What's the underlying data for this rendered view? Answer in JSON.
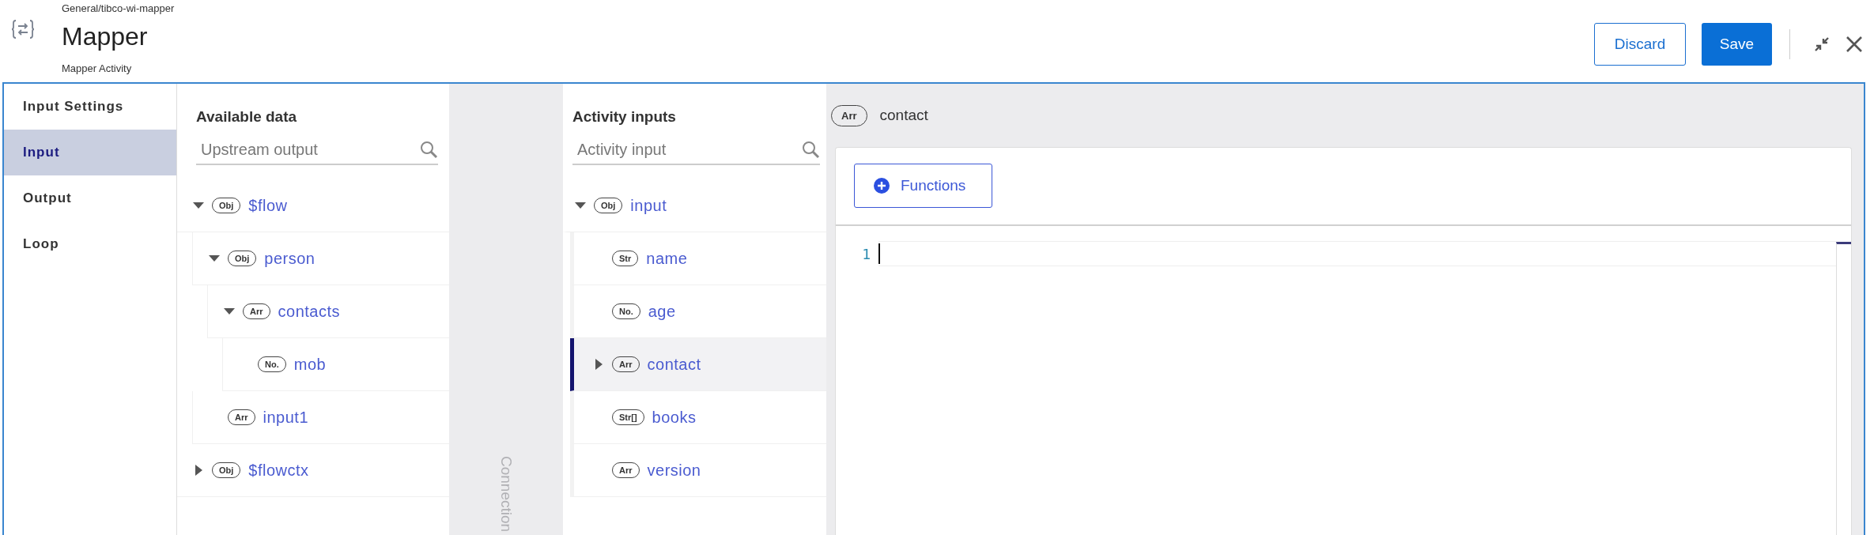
{
  "header": {
    "breadcrumb": "General/tibco-wi-mapper",
    "title": "Mapper",
    "subtitle": "Mapper Activity",
    "buttons": [
      {
        "label": "Discard",
        "kind": "secondary"
      },
      {
        "label": "Save",
        "kind": "primary"
      }
    ]
  },
  "nav": [
    {
      "label": "Input Settings",
      "selected": false
    },
    {
      "label": "Input",
      "selected": true
    },
    {
      "label": "Output",
      "selected": false
    },
    {
      "label": "Loop",
      "selected": false
    }
  ],
  "available_data": {
    "title": "Available data",
    "search": {
      "placeholder": "Upstream output"
    },
    "tree": [
      {
        "type": "Obj",
        "name": "$flow",
        "expanded": true,
        "children": [
          {
            "type": "Obj",
            "name": "person",
            "expanded": true,
            "children": [
              {
                "type": "Arr",
                "name": "contacts",
                "expanded": true,
                "children": [
                  {
                    "type": "No.",
                    "name": "mob"
                  }
                ]
              }
            ]
          },
          {
            "type": "Arr",
            "name": "input1"
          }
        ]
      },
      {
        "type": "Obj",
        "name": "$flowctx",
        "expanded": false
      }
    ]
  },
  "connection": {
    "label": "Connection"
  },
  "activity_inputs": {
    "title": "Activity inputs",
    "search": {
      "placeholder": "Activity input"
    },
    "tree": [
      {
        "type": "Obj",
        "name": "input",
        "expanded": true,
        "selected": false,
        "children": [
          {
            "type": "Str",
            "name": "name",
            "selected": false
          },
          {
            "type": "No.",
            "name": "age",
            "selected": false
          },
          {
            "type": "Arr",
            "name": "contact",
            "expanded": false,
            "selected": true
          },
          {
            "type": "Str[]",
            "name": "books",
            "selected": false
          },
          {
            "type": "Arr",
            "name": "version",
            "selected": false
          }
        ]
      }
    ]
  },
  "editor": {
    "type": "Arr",
    "name": "contact",
    "functions_button": "Functions",
    "line_numbers": [
      "1"
    ]
  }
}
